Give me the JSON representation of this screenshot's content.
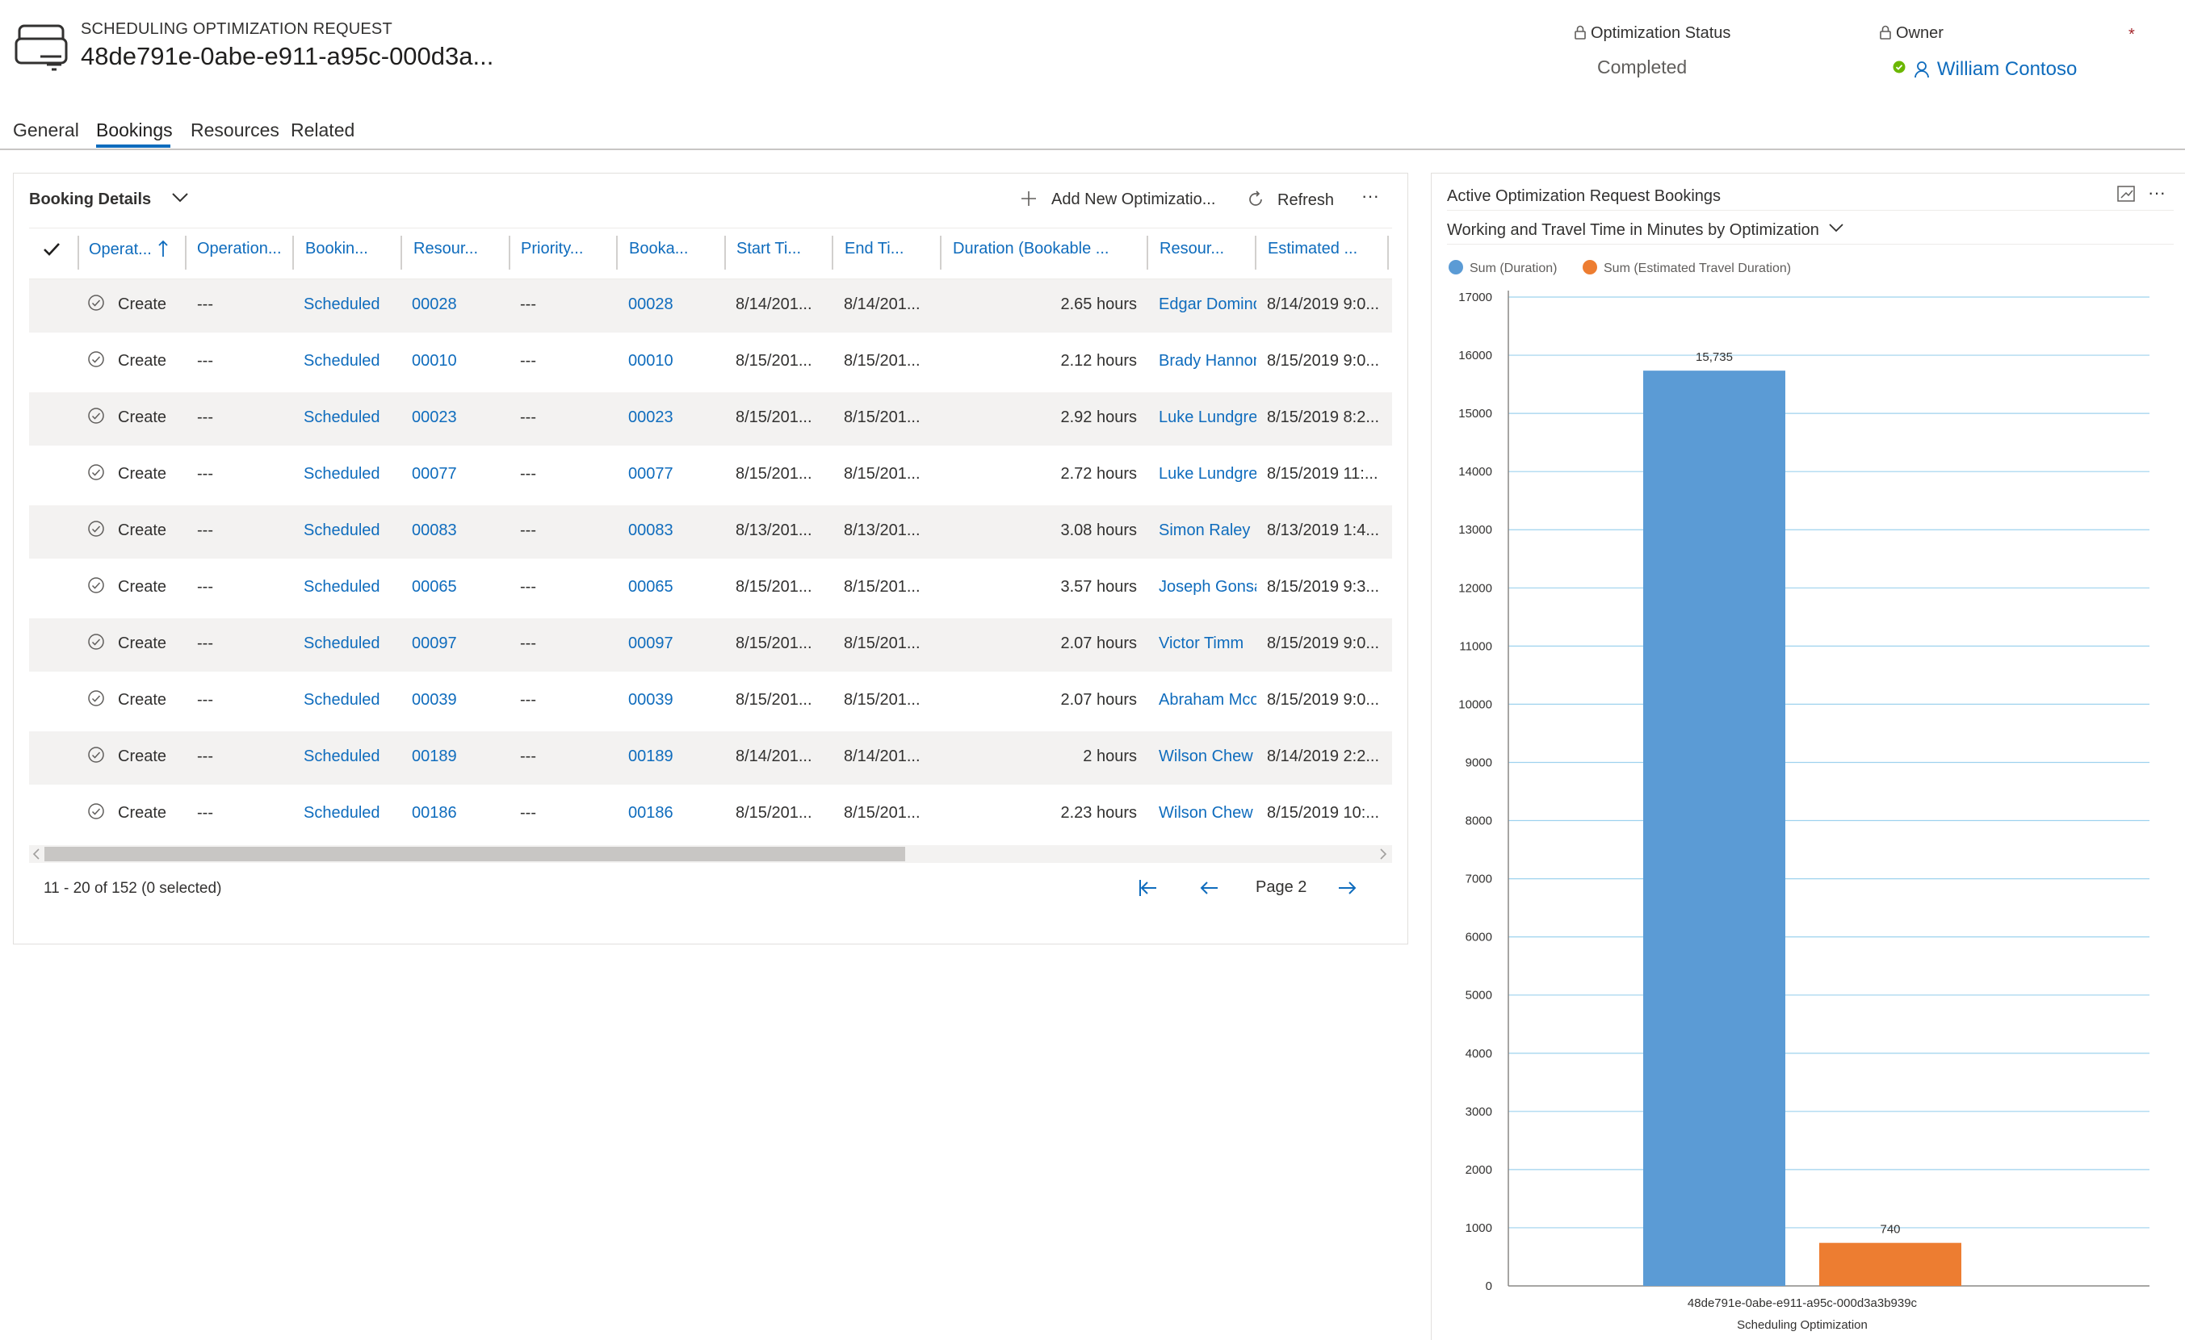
{
  "header": {
    "entity_type": "SCHEDULING OPTIMIZATION REQUEST",
    "record_name": "48de791e-0abe-e911-a95c-000d3a...",
    "status_label": "Optimization Status",
    "status_value": "Completed",
    "owner_label": "Owner",
    "owner_value": "William Contoso",
    "required_marker": "*"
  },
  "tabs": [
    "General",
    "Bookings",
    "Resources",
    "Related"
  ],
  "active_tab": "Bookings",
  "grid": {
    "title": "Booking Details",
    "commands": {
      "add": "Add New Optimizatio...",
      "refresh": "Refresh",
      "more": "···"
    },
    "columns": [
      "Operat...",
      "Operation...",
      "Bookin...",
      "Resour...",
      "Priority...",
      "Booka...",
      "Start Ti...",
      "End Ti...",
      "Duration (Bookable ...",
      "Resour...",
      "Estimated ..."
    ],
    "sort_column": "Operat...",
    "rows": [
      {
        "operation": "Create",
        "opnote": "---",
        "booking_status": "Scheduled",
        "resource_req": "00028",
        "priority": "---",
        "bookable": "00028",
        "start": "8/14/201...",
        "end": "8/14/201...",
        "duration": "2.65 hours",
        "resource": "Edgar Dominq",
        "estimated": "8/14/2019 9:0..."
      },
      {
        "operation": "Create",
        "opnote": "---",
        "booking_status": "Scheduled",
        "resource_req": "00010",
        "priority": "---",
        "bookable": "00010",
        "start": "8/15/201...",
        "end": "8/15/201...",
        "duration": "2.12 hours",
        "resource": "Brady Hannon",
        "estimated": "8/15/2019 9:0..."
      },
      {
        "operation": "Create",
        "opnote": "---",
        "booking_status": "Scheduled",
        "resource_req": "00023",
        "priority": "---",
        "bookable": "00023",
        "start": "8/15/201...",
        "end": "8/15/201...",
        "duration": "2.92 hours",
        "resource": "Luke Lundgrer",
        "estimated": "8/15/2019 8:2..."
      },
      {
        "operation": "Create",
        "opnote": "---",
        "booking_status": "Scheduled",
        "resource_req": "00077",
        "priority": "---",
        "bookable": "00077",
        "start": "8/15/201...",
        "end": "8/15/201...",
        "duration": "2.72 hours",
        "resource": "Luke Lundgrer",
        "estimated": "8/15/2019 11:..."
      },
      {
        "operation": "Create",
        "opnote": "---",
        "booking_status": "Scheduled",
        "resource_req": "00083",
        "priority": "---",
        "bookable": "00083",
        "start": "8/13/201...",
        "end": "8/13/201...",
        "duration": "3.08 hours",
        "resource": "Simon Raley",
        "estimated": "8/13/2019 1:4..."
      },
      {
        "operation": "Create",
        "opnote": "---",
        "booking_status": "Scheduled",
        "resource_req": "00065",
        "priority": "---",
        "bookable": "00065",
        "start": "8/15/201...",
        "end": "8/15/201...",
        "duration": "3.57 hours",
        "resource": "Joseph Gonsal",
        "estimated": "8/15/2019 9:3..."
      },
      {
        "operation": "Create",
        "opnote": "---",
        "booking_status": "Scheduled",
        "resource_req": "00097",
        "priority": "---",
        "bookable": "00097",
        "start": "8/15/201...",
        "end": "8/15/201...",
        "duration": "2.07 hours",
        "resource": "Victor Timm",
        "estimated": "8/15/2019 9:0..."
      },
      {
        "operation": "Create",
        "opnote": "---",
        "booking_status": "Scheduled",
        "resource_req": "00039",
        "priority": "---",
        "bookable": "00039",
        "start": "8/15/201...",
        "end": "8/15/201...",
        "duration": "2.07 hours",
        "resource": "Abraham Mcoı",
        "estimated": "8/15/2019 9:0..."
      },
      {
        "operation": "Create",
        "opnote": "---",
        "booking_status": "Scheduled",
        "resource_req": "00189",
        "priority": "---",
        "bookable": "00189",
        "start": "8/14/201...",
        "end": "8/14/201...",
        "duration": "2 hours",
        "resource": "Wilson Chew",
        "estimated": "8/14/2019 2:2..."
      },
      {
        "operation": "Create",
        "opnote": "---",
        "booking_status": "Scheduled",
        "resource_req": "00186",
        "priority": "---",
        "bookable": "00186",
        "start": "8/15/201...",
        "end": "8/15/201...",
        "duration": "2.23 hours",
        "resource": "Wilson Chew",
        "estimated": "8/15/2019 10:..."
      }
    ],
    "footer": "11 - 20 of 152 (0 selected)",
    "page_label": "Page 2"
  },
  "chart_panel": {
    "title": "Active Optimization Request Bookings",
    "view_name": "Working and Travel Time in Minutes by Optimization"
  },
  "colors": {
    "accent": "#0f6cbd",
    "series_duration": "#5b9bd5",
    "series_travel": "#ed7d31"
  },
  "chart_data": {
    "type": "bar",
    "categories": [
      "48de791e-0abe-e911-a95c-000d3a3b939c"
    ],
    "series": [
      {
        "name": "Sum (Duration)",
        "values": [
          15735
        ],
        "labels": [
          "15,735"
        ]
      },
      {
        "name": "Sum (Estimated Travel Duration)",
        "values": [
          740
        ],
        "labels": [
          "740"
        ]
      }
    ],
    "xlabel": "Scheduling Optimization",
    "ylabel": "",
    "ylim": [
      0,
      17000
    ],
    "yticks": [
      "0",
      "1000",
      "2000",
      "3000",
      "4000",
      "5000",
      "6000",
      "7000",
      "8000",
      "9000",
      "10000",
      "11000",
      "12000",
      "13000",
      "14000",
      "15000",
      "16000",
      "17000"
    ],
    "grid": true,
    "legend": "top-left"
  }
}
